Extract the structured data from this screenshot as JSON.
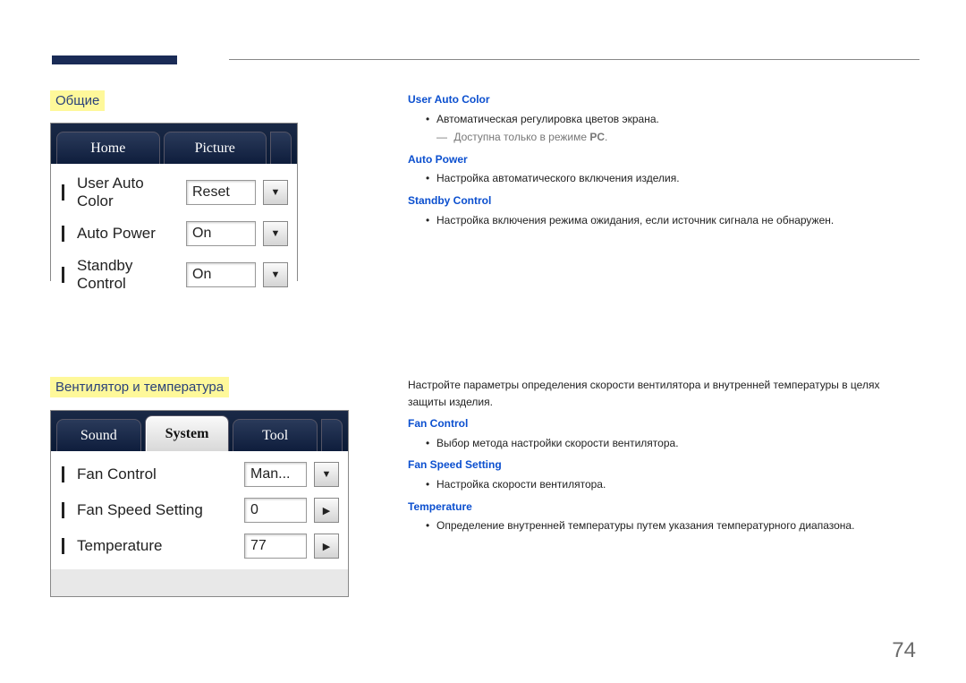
{
  "sections": {
    "general": {
      "title": "Общие"
    },
    "fan": {
      "title": "Вентилятор и температура"
    }
  },
  "panel1": {
    "tabs": {
      "home": "Home",
      "picture": "Picture"
    },
    "rows": {
      "userAutoColor": {
        "label": "User Auto Color",
        "value": "Reset"
      },
      "autoPower": {
        "label": "Auto Power",
        "value": "On"
      },
      "standbyControl": {
        "label": "Standby Control",
        "value": "On"
      }
    }
  },
  "panel2": {
    "tabs": {
      "sound": "Sound",
      "system": "System",
      "tool": "Tool"
    },
    "rows": {
      "fanControl": {
        "label": "Fan Control",
        "value": "Man..."
      },
      "fanSpeed": {
        "label": "Fan Speed Setting",
        "value": "0"
      },
      "temperature": {
        "label": "Temperature",
        "value": "77"
      }
    }
  },
  "desc1": {
    "userAutoColor": {
      "term": "User Auto Color",
      "bullet": "Автоматическая регулировка цветов экрана.",
      "notePrefix": "Доступна только в режиме ",
      "noteBold": "PC",
      "noteSuffix": "."
    },
    "autoPower": {
      "term": "Auto Power",
      "bullet": "Настройка автоматического включения изделия."
    },
    "standbyControl": {
      "term": "Standby Control",
      "bullet": "Настройка включения режима ожидания, если источник сигнала не обнаружен."
    }
  },
  "desc2": {
    "intro": "Настройте параметры определения скорости вентилятора и внутренней температуры в целях защиты изделия.",
    "fanControl": {
      "term": "Fan Control",
      "bullet": "Выбор метода настройки скорости вентилятора."
    },
    "fanSpeed": {
      "term": "Fan Speed Setting",
      "bullet": "Настройка скорости вентилятора."
    },
    "temperature": {
      "term": "Temperature",
      "bullet": "Определение внутренней температуры путем указания температурного диапазона."
    }
  },
  "pageNumber": "74"
}
